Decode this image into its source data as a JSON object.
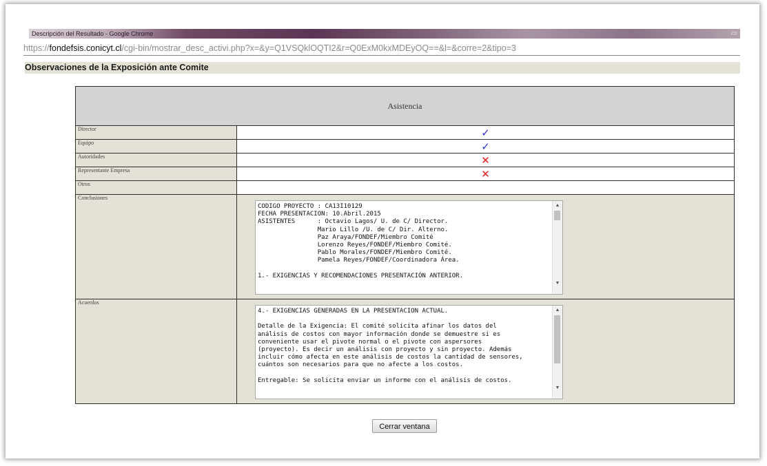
{
  "window": {
    "title": "Descripción del Resultado - Google Chrome",
    "url_prefix": "https://",
    "url_host": "fondefsis.conicyt.cl",
    "url_path": "/cgi-bin/mostrar_desc_activi.php?x=&y=Q1VSQklOQTI2&r=Q0ExM0kxMDEyOQ==&l=&corre=2&tipo=3"
  },
  "page": {
    "heading": "Observaciones de la Exposición ante Comite"
  },
  "table": {
    "header": "Asistencia",
    "rows": [
      {
        "label": "Director",
        "mark": "✓",
        "mark_type": "check"
      },
      {
        "label": "Equipo",
        "mark": "✓",
        "mark_type": "check"
      },
      {
        "label": "Autoridades",
        "mark": "✕",
        "mark_type": "cross"
      },
      {
        "label": "Representante Empresa",
        "mark": "✕",
        "mark_type": "cross"
      },
      {
        "label": "Otros",
        "mark": "",
        "mark_type": "none"
      }
    ],
    "conclusiones_label": "Conclusiones",
    "conclusiones_text": "CODIGO PROYECTO : CA13I10129\nFECHA PRESENTACION: 10.Abril.2015\nASISTENTES      : Octavio Lagos/ U. de C/ Director.\n                Mario Lillo /U. de C/ Dir. Alterno.\n                Paz Araya/FONDEF/Miembro Comité\n                Lorenzo Reyes/FONDEF/Miembro Comité.\n                Pablo Morales/FONDEF/Miembro Comité.\n                Pamela Reyes/FONDEF/Coordinadora Área.\n\n1.- EXIGENCIAS Y RECOMENDACIONES PRESENTACIÓN ANTERIOR.",
    "acuerdos_label": "Acuerdos",
    "acuerdos_text": "4.- EXIGENCIAS GENERADAS EN LA PRESENTACIÓN ACTUAL.\n\nDetalle de la Exigencia: El comité solicita afinar los datos del\nanálisis de costos con mayor información donde se demuestre si es\nconveniente usar el pivote normal o el pivote con aspersores\n(proyecto). Es decir un análisis con proyecto y sin proyecto. Además\nincluir cómo afecta en este análisis de costos la cantidad de sensores,\ncuántos son necesarios para que no afecte a los costos.\n\nEntregable: Se solicita enviar un informe con el análisis de costos."
  },
  "close_button": "Cerrar ventana",
  "colors": {
    "check": "#2f2fd0",
    "cross": "#e21b1b",
    "label_bg": "#e4e2d6",
    "header_bg": "#d3d3d3"
  }
}
